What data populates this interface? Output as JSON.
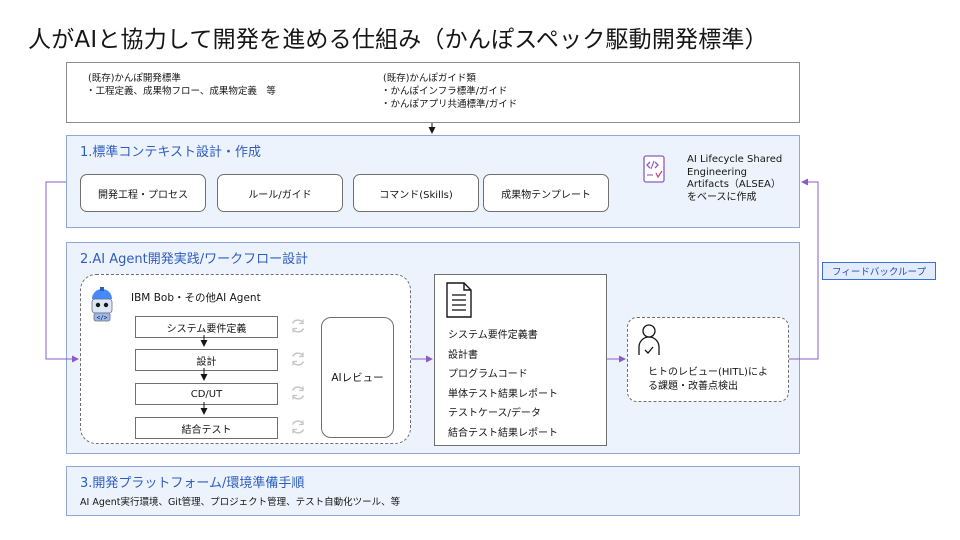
{
  "title": "人がAIと協力して開発を進める仕組み（かんぽスペック駆動開発標準）",
  "sources": {
    "left_heading": "(既存)かんぽ開発標準",
    "left_items": [
      "・工程定義、成果物フロー、成果物定義　等"
    ],
    "right_heading": "(既存)かんぽガイド類",
    "right_items": [
      "・かんぽインフラ標準/ガイド",
      "・かんぽアプリ共通標準/ガイド"
    ]
  },
  "section1": {
    "title": "1.標準コンテキスト設計・作成",
    "pills": [
      "開発工程・プロセス",
      "ルール/ガイド",
      "コマンド(Skills)",
      "成果物テンプレート"
    ],
    "alsea_lines": [
      "AI Lifecycle Shared",
      "Engineering",
      "Artifacts（ALSEA）",
      "をベースに作成"
    ]
  },
  "section2": {
    "title": "2.AI Agent開発実践/ワークフロー設計",
    "agent_label": "IBM Bob・その他AI Agent",
    "steps": [
      "システム要件定義",
      "設計",
      "CD/UT",
      "結合テスト"
    ],
    "ai_review": "AIレビュー",
    "deliverables": [
      "システム要件定義書",
      "設計書",
      "プログラムコード",
      "単体テスト結果レポート",
      "テストケース/データ",
      "結合テスト結果レポート"
    ],
    "human_review_lines": [
      "ヒトのレビュー(HITL)によ",
      "る課題・改善点検出"
    ]
  },
  "section3": {
    "title": "3.開発プラットフォーム/環境準備手順",
    "body": "AI Agent実行環境、Git管理、プロジェクト管理、テスト自動化ツール、等"
  },
  "feedback_label": "フィードバックループ",
  "colors": {
    "accent": "#2f5dbe",
    "section_bg": "#edf3fd",
    "loop": "#8a5cc7",
    "feedback_bg": "#e3ecfd"
  }
}
